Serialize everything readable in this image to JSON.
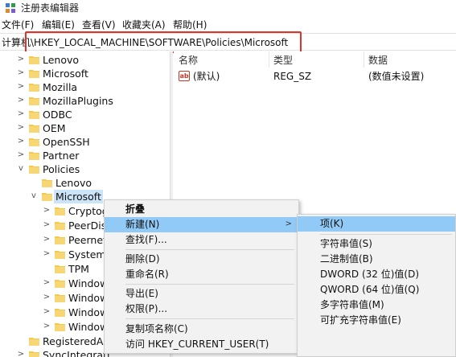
{
  "window": {
    "title": "注册表编辑器"
  },
  "menubar": [
    {
      "label": "文件(F)"
    },
    {
      "label": "编辑(E)"
    },
    {
      "label": "查看(V)"
    },
    {
      "label": "收藏夹(A)"
    },
    {
      "label": "帮助(H)"
    }
  ],
  "address": {
    "path": "计算机\\HKEY_LOCAL_MACHINE\\SOFTWARE\\Policies\\Microsoft"
  },
  "tree": [
    {
      "label": "Lenovo",
      "expander": ">"
    },
    {
      "label": "Microsoft",
      "expander": ">"
    },
    {
      "label": "Mozilla",
      "expander": ">"
    },
    {
      "label": "MozillaPlugins",
      "expander": ">"
    },
    {
      "label": "ODBC",
      "expander": ">"
    },
    {
      "label": "OEM",
      "expander": ">"
    },
    {
      "label": "OpenSSH",
      "expander": ">"
    },
    {
      "label": "Partner",
      "expander": ">"
    },
    {
      "label": "Policies",
      "expander": "v"
    },
    {
      "label": "Lenovo",
      "expander": ""
    },
    {
      "label": "Microsoft",
      "expander": "v"
    },
    {
      "label": "Cryptog",
      "expander": ">"
    },
    {
      "label": "PeerDis",
      "expander": ">"
    },
    {
      "label": "Peernet",
      "expander": ">"
    },
    {
      "label": "System",
      "expander": ">"
    },
    {
      "label": "TPM",
      "expander": ""
    },
    {
      "label": "Window",
      "expander": ">"
    },
    {
      "label": "Window",
      "expander": ">"
    },
    {
      "label": "Window",
      "expander": ">"
    },
    {
      "label": "Window",
      "expander": ">"
    },
    {
      "label": "RegisteredAp",
      "expander": ""
    },
    {
      "label": "SyncIntegrati",
      "expander": ">"
    }
  ],
  "list": {
    "columns": {
      "name": "名称",
      "type": "类型",
      "data": "数据"
    },
    "rows": [
      {
        "icon": "ab",
        "name": "(默认)",
        "type": "REG_SZ",
        "data": "(数值未设置)"
      }
    ]
  },
  "context_menu": {
    "items": [
      {
        "label": "折叠",
        "bold": true
      },
      {
        "label": "新建(N)",
        "arrow": ">"
      },
      {
        "label": "查找(F)..."
      },
      {
        "label": "删除(D)"
      },
      {
        "label": "重命名(R)"
      },
      {
        "label": "导出(E)"
      },
      {
        "label": "权限(P)..."
      },
      {
        "label": "复制项名称(C)"
      },
      {
        "label": "访问 HKEY_CURRENT_USER(T)"
      }
    ]
  },
  "submenu": {
    "items": [
      {
        "label": "项(K)"
      },
      {
        "label": "字符串值(S)"
      },
      {
        "label": "二进制值(B)"
      },
      {
        "label": "DWORD (32 位)值(D)"
      },
      {
        "label": "QWORD (64 位)值(Q)"
      },
      {
        "label": "多字符串值(M)"
      },
      {
        "label": "可扩充字符串值(E)"
      }
    ]
  },
  "colors": {
    "highlight_box": "#e0342a",
    "menu_hover": "#91c9f7",
    "selected": "#cce4f7",
    "folder": "#f3c94e"
  }
}
